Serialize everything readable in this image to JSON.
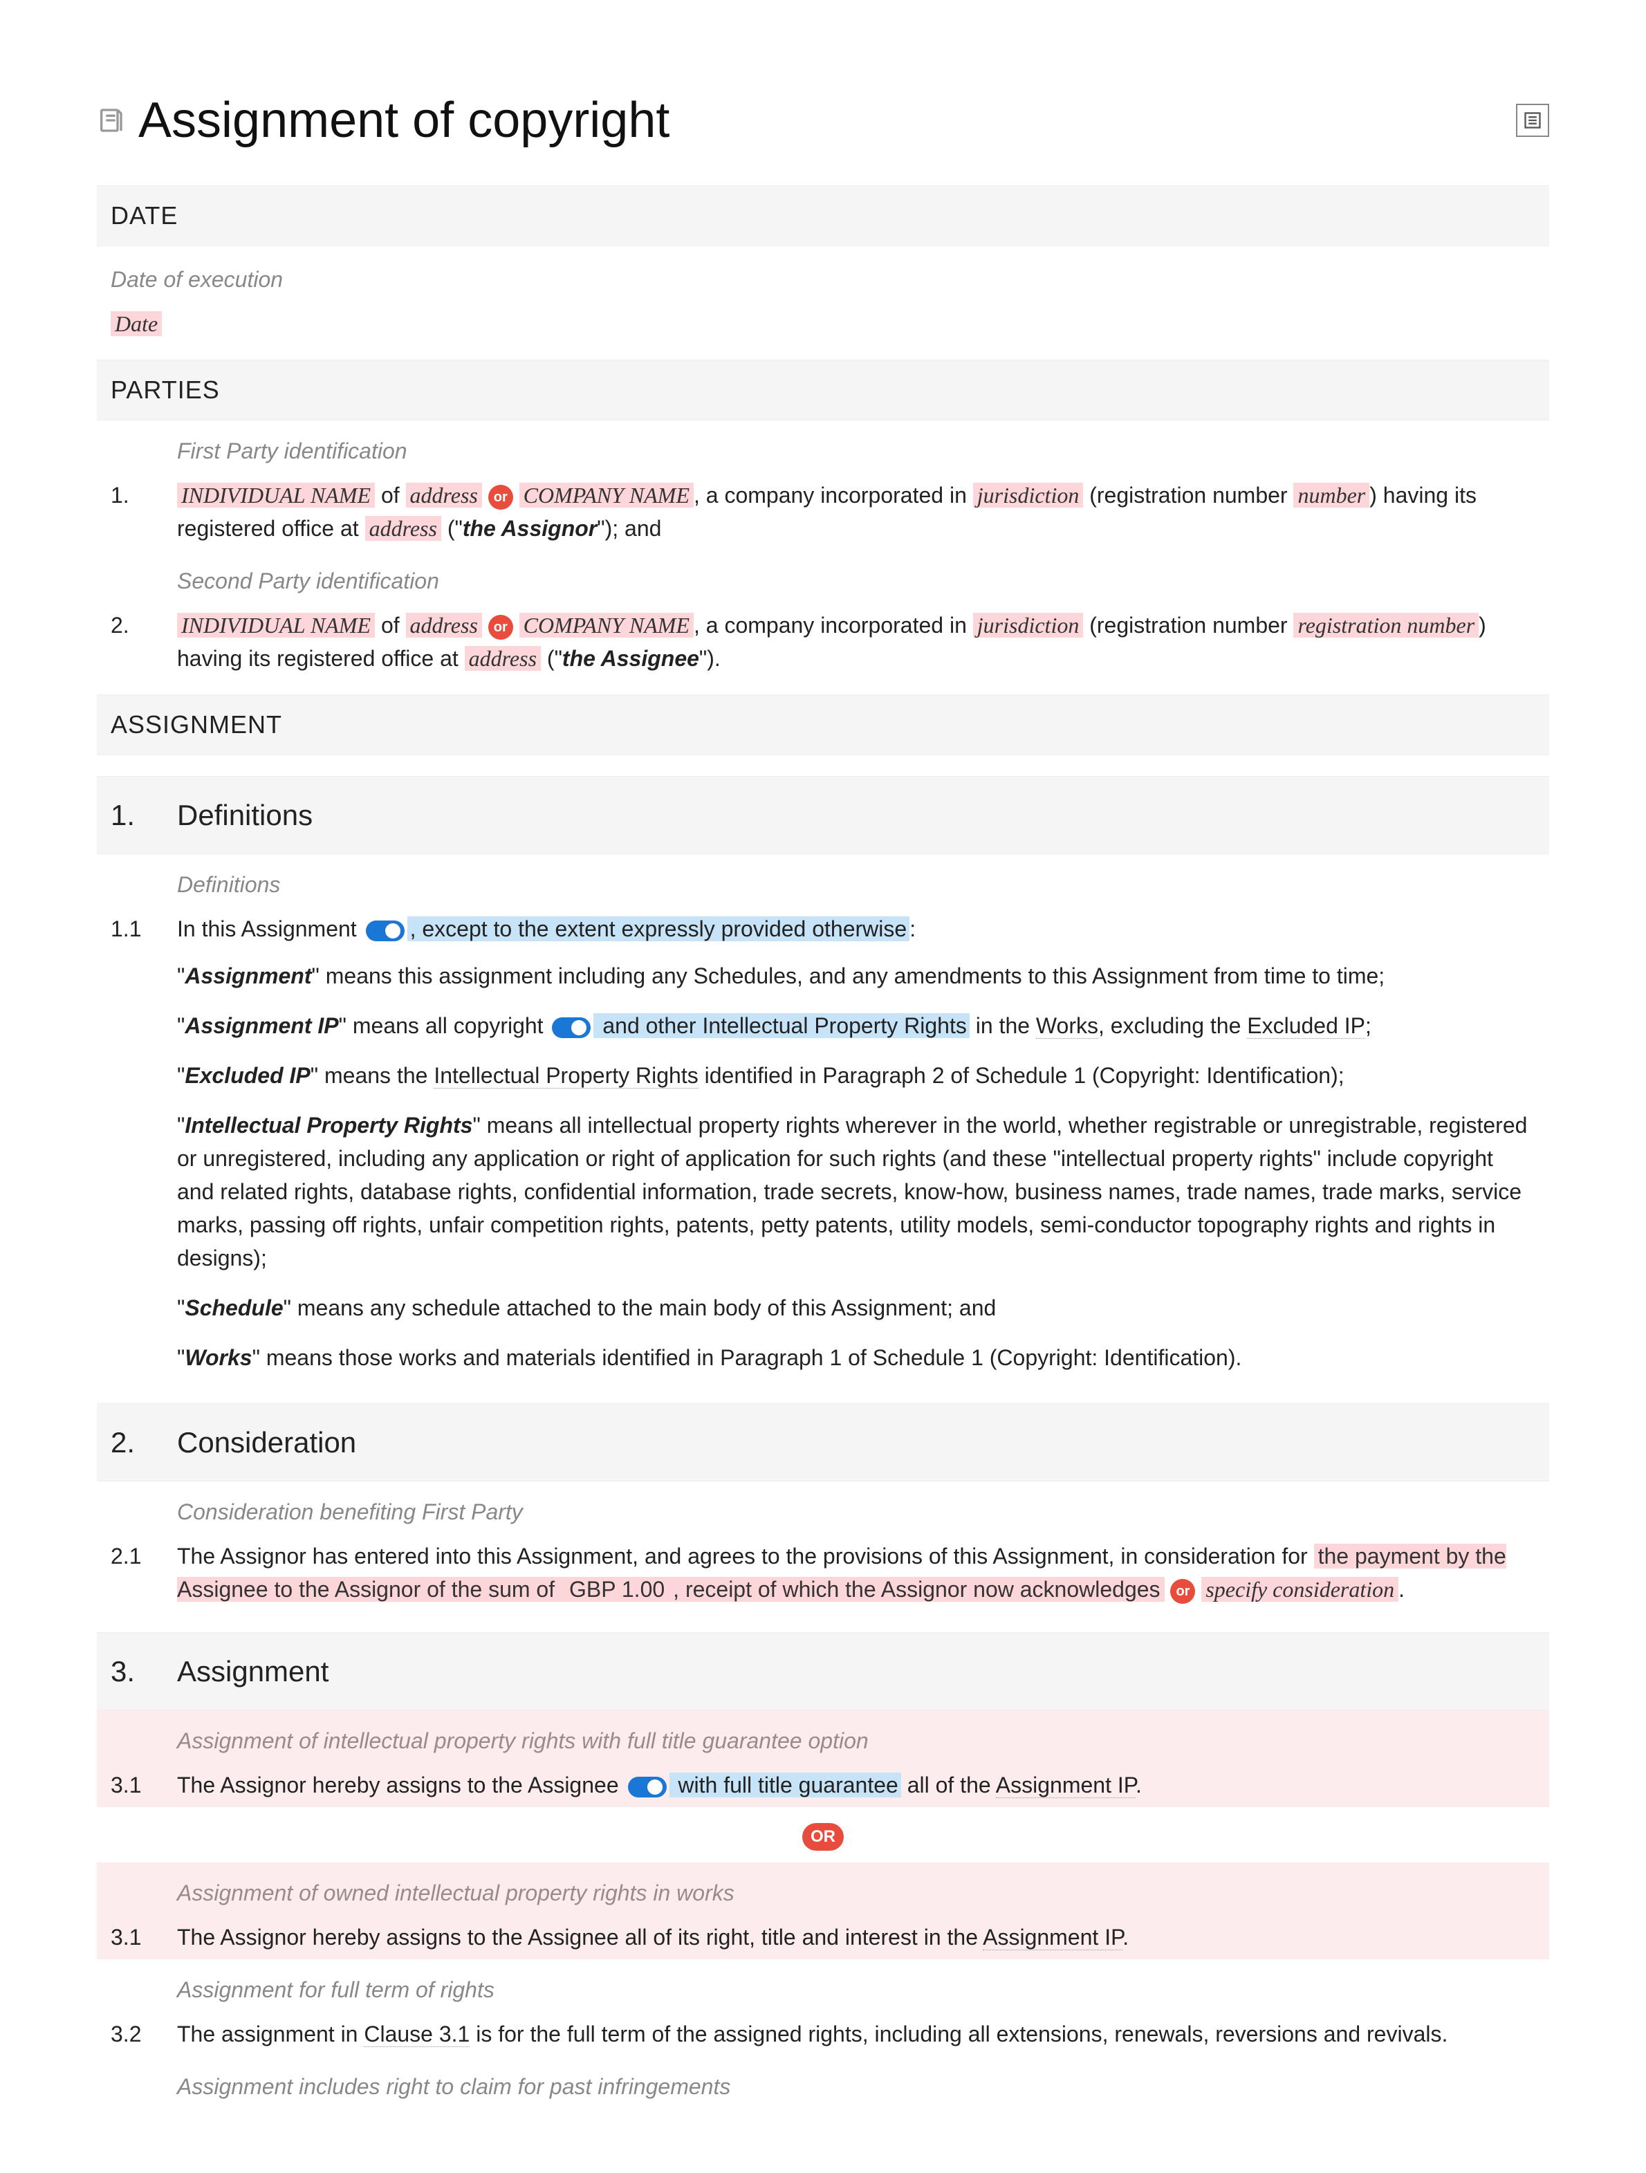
{
  "title": "Assignment of copyright",
  "sections": {
    "date": {
      "heading": "DATE",
      "caption": "Date of execution",
      "value": "Date"
    },
    "parties": {
      "heading": "PARTIES",
      "items": [
        {
          "num": "1.",
          "caption": "First Party identification",
          "fields": {
            "indName": "INDIVIDUAL NAME",
            "of": " of ",
            "address1": "address",
            "compName": "COMPANY NAME",
            "incorpText": ", a company incorporated in ",
            "jurisdiction": "jurisdiction",
            "regText": " (registration number ",
            "number": "number",
            "officeText": ") having its registered office at ",
            "address2": "address",
            "roleOpen": " (\"",
            "role": "the Assignor",
            "roleClose": "\"); and"
          },
          "or": "or"
        },
        {
          "num": "2.",
          "caption": "Second Party identification",
          "fields": {
            "indName": "INDIVIDUAL NAME",
            "of": " of ",
            "address1": "address",
            "compName": "COMPANY NAME",
            "incorpText": ", a company incorporated in ",
            "jurisdiction": "jurisdiction",
            "regText": " (registration number ",
            "number": "registration number",
            "officeText": ") having its registered office at ",
            "address2": "address",
            "roleOpen": " (\"",
            "role": "the Assignee",
            "roleClose": "\")."
          },
          "or": "or"
        }
      ]
    },
    "assignmentHeading": "ASSIGNMENT",
    "definitions": {
      "num": "1.",
      "title": "Definitions",
      "caption": "Definitions",
      "lead": {
        "num": "1.1",
        "pre": "In this Assignment",
        "opt": ", except to the extent expressly provided otherwise",
        "post": ":"
      },
      "defs": [
        {
          "term": "Assignment",
          "pre": "\"",
          "mid": "\" means this assignment including any Schedules, and any amendments to this Assignment from time to time;"
        },
        {
          "term": "Assignment IP",
          "pre": "\"",
          "mid": "\" means all copyright ",
          "opt": " and other Intellectual Property Rights",
          "post": " in the ",
          "link1": "Works",
          "post2": ", excluding the ",
          "link2": "Excluded IP",
          "post3": ";"
        },
        {
          "term": "Excluded IP",
          "pre": "\"",
          "mid": "\" means the ",
          "link1": "Intellectual Property Rights",
          "post": " identified in Paragraph 2 of Schedule 1 (Copyright: Identification);"
        },
        {
          "term": "Intellectual Property Rights",
          "pre": "\"",
          "mid": "\" means all intellectual property rights wherever in the world, whether registrable or unregistrable, registered or unregistered, including any application or right of application for such rights (and these \"intellectual property rights\" include copyright and related rights, database rights, confidential information, trade secrets, know-how, business names, trade names, trade marks, service marks, passing off rights, unfair competition rights, patents, petty patents, utility models, semi-conductor topography rights and rights in designs);"
        },
        {
          "term": "Schedule",
          "pre": "\"",
          "mid": "\" means any schedule attached to the main body of this Assignment; and"
        },
        {
          "term": "Works",
          "pre": "\"",
          "mid": "\" means those works and materials identified in Paragraph 1 of Schedule 1 (Copyright: Identification)."
        }
      ]
    },
    "consideration": {
      "num": "2.",
      "title": "Consideration",
      "caption": "Consideration benefiting First Party",
      "item": {
        "num": "2.1",
        "text1": "The Assignor has entered into this Assignment, and agrees to the provisions of this Assignment, in consideration for ",
        "hl1": "the payment by the Assignee to the Assignor of the sum of ",
        "hl2": "GBP 1.00",
        "hl3": ", receipt of which the Assignor now acknowledges",
        "or": "or",
        "alt": "specify consideration",
        "end": "."
      }
    },
    "assignment": {
      "num": "3.",
      "title": "Assignment",
      "alt1": {
        "caption": "Assignment of intellectual property rights with full title guarantee option",
        "num": "3.1",
        "pre": "The Assignor hereby assigns to the Assignee",
        "opt": " with full title guarantee",
        "post": " all of the ",
        "link": "Assignment IP",
        "end": "."
      },
      "orBlock": "OR",
      "alt2": {
        "caption": "Assignment of owned intellectual property rights in works",
        "num": "3.1",
        "text": "The Assignor hereby assigns to the Assignee all of its right, title and interest in the ",
        "link": "Assignment IP",
        "end": "."
      },
      "item2": {
        "caption": "Assignment for full term of rights",
        "num": "3.2",
        "pre": "The assignment in ",
        "link": "Clause 3.1",
        "post": " is for the full term of the assigned rights, including all extensions, renewals, reversions and revivals."
      },
      "trail": "Assignment includes right to claim for past infringements"
    }
  }
}
